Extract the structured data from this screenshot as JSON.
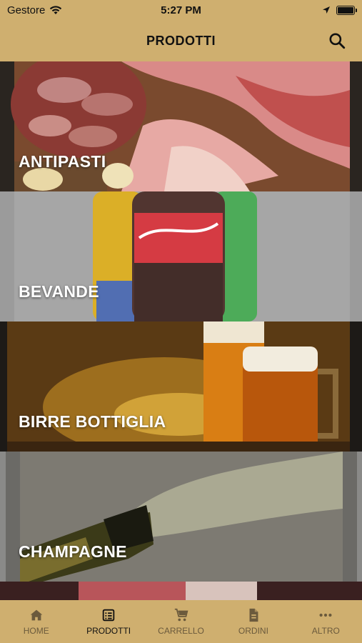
{
  "status": {
    "carrier": "Gestore",
    "time": "5:27 PM"
  },
  "header": {
    "title": "PRODOTTI"
  },
  "categories": [
    {
      "label": "ANTIPASTI"
    },
    {
      "label": "BEVANDE"
    },
    {
      "label": "BIRRE BOTTIGLIA"
    },
    {
      "label": "CHAMPAGNE"
    }
  ],
  "tabs": [
    {
      "label": "HOME",
      "icon": "home-icon"
    },
    {
      "label": "PRODOTTI",
      "icon": "list-icon"
    },
    {
      "label": "CARRELLO",
      "icon": "cart-icon"
    },
    {
      "label": "ORDINI",
      "icon": "document-icon"
    },
    {
      "label": "ALTRO",
      "icon": "more-icon"
    }
  ],
  "colors": {
    "header_bg": "#cfaf6f",
    "tab_active": "#111111",
    "tab_inactive": "#6b5a3c"
  }
}
